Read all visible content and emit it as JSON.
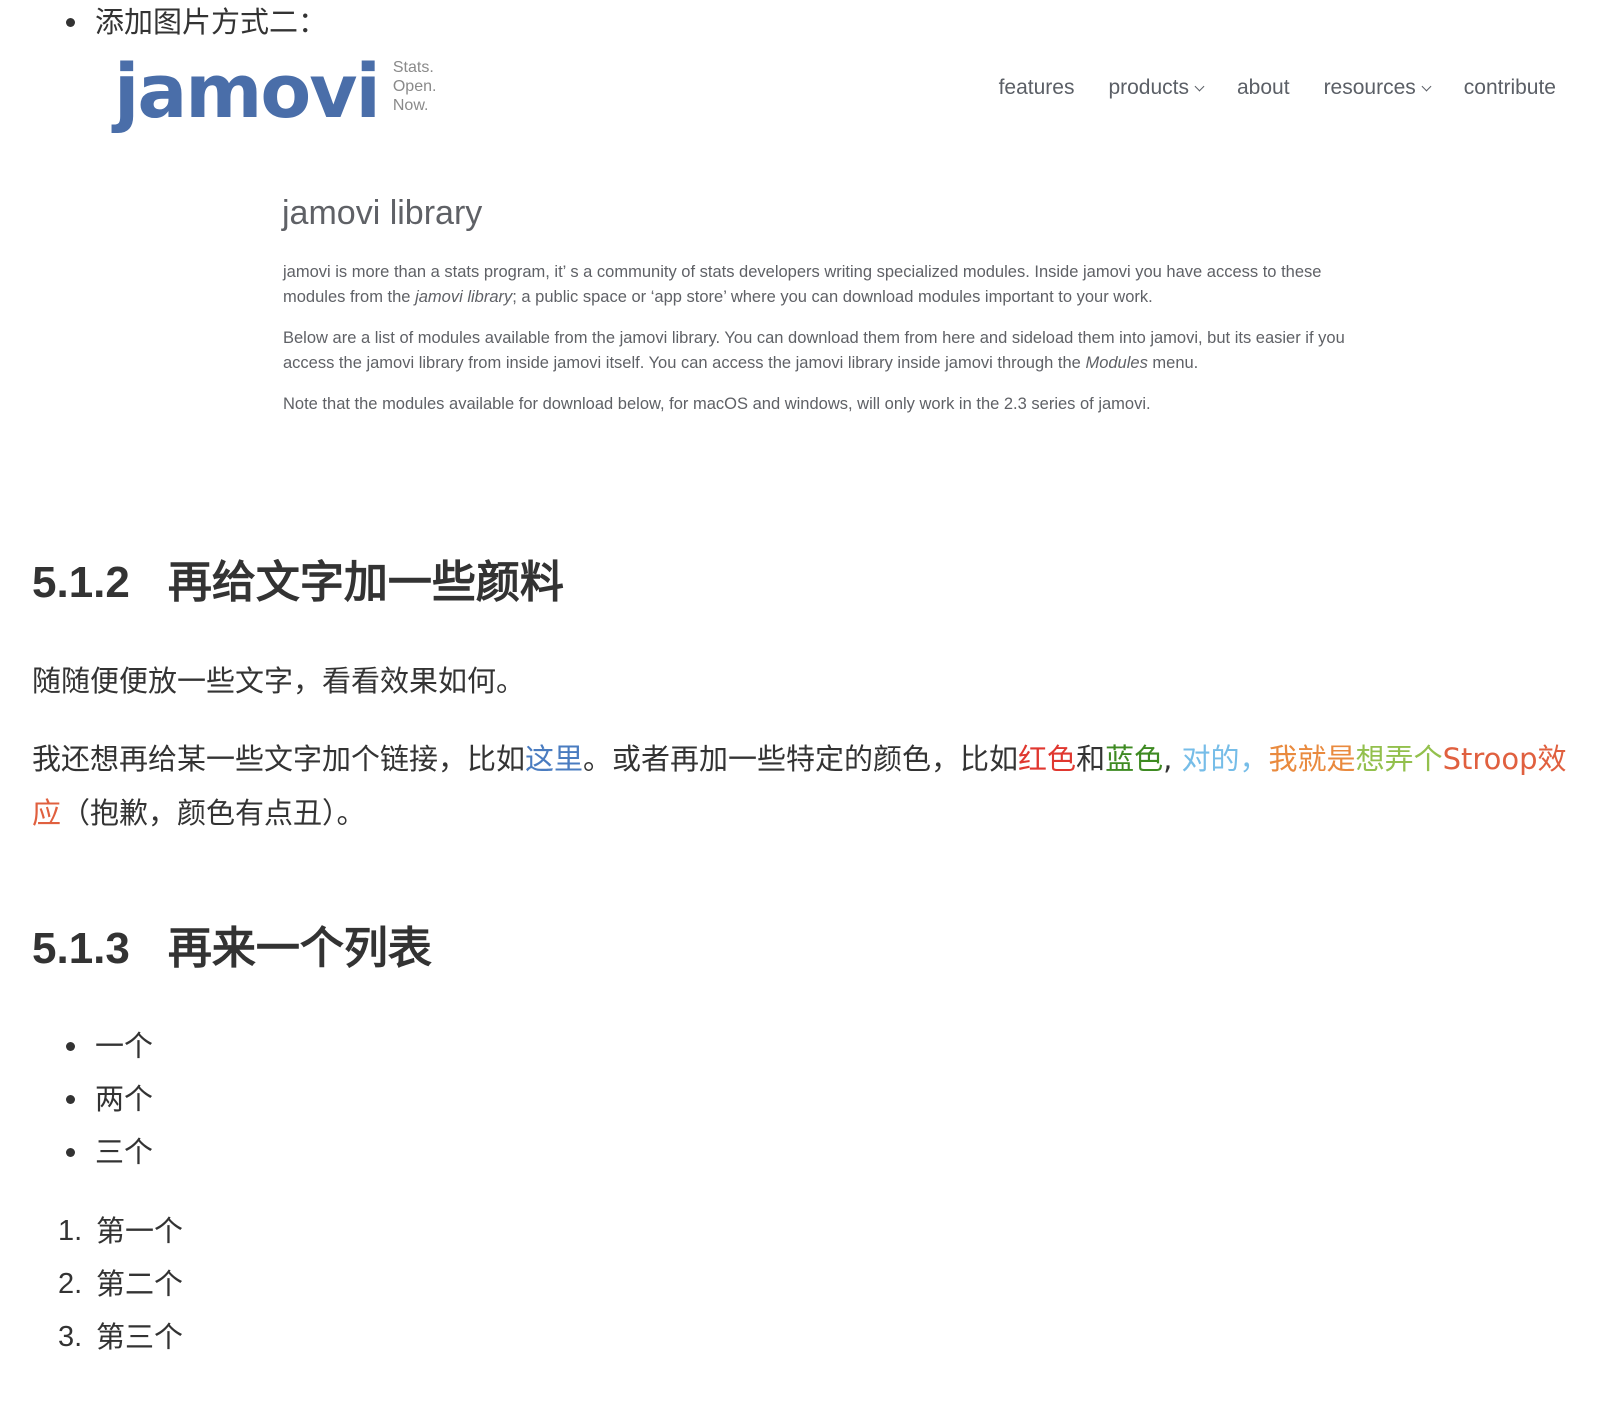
{
  "top_bullet": {
    "text": "添加图片方式二："
  },
  "embedded_image": {
    "logo": {
      "word": "jamovi",
      "tagline": [
        "Stats.",
        "Open.",
        "Now."
      ],
      "color": "#4a6ea9"
    },
    "nav": [
      {
        "label": "features",
        "dropdown": false
      },
      {
        "label": "products",
        "dropdown": true
      },
      {
        "label": "about",
        "dropdown": false
      },
      {
        "label": "resources",
        "dropdown": true
      },
      {
        "label": "contribute",
        "dropdown": false
      }
    ],
    "title": "jamovi library",
    "paragraphs": {
      "p1_a": "jamovi is more than a stats program, it’ s a community of stats developers writing specialized modules. Inside jamovi you have access to these modules from the ",
      "p1_em": "jamovi library",
      "p1_b": "; a public space or  ‘app store’  where you can download modules important to your work.",
      "p2_a": "Below are a list of modules available from the jamovi library. You can download them from here and sideload them into jamovi, but its easier if you access the jamovi library from inside jamovi itself. You can access the jamovi library inside jamovi through the ",
      "p2_em": "Modules",
      "p2_b": " menu.",
      "p3": "Note that the modules available for download below, for macOS and windows, will only work in the 2.3 series of jamovi."
    }
  },
  "section_512": {
    "number": "5.1.2",
    "title": "再给文字加一些颜料",
    "para1": "随随便便放一些文字，看看效果如何。",
    "para2": {
      "s1": "我还想再给某一些文字加个链接，比如",
      "link": "这里",
      "s2": "。或者再加一些特定的颜色，比如",
      "red": "红色",
      "s3": "和",
      "green": "蓝色",
      "s4": ",",
      "sky": "对的，",
      "orange": "我就是",
      "lime": "想弄个",
      "tomato": "Stroop效应",
      "s5": "（抱歉，颜色有点丑）。"
    },
    "colors": {
      "link": "#4a7cc0",
      "red": "#e0372f",
      "green": "#3e8a22",
      "sky": "#76bde8",
      "orange": "#e98a3e",
      "lime": "#93c04d",
      "tomato": "#e0603f"
    }
  },
  "section_513": {
    "number": "5.1.3",
    "title": "再来一个列表",
    "bullets": [
      "一个",
      "两个",
      "三个"
    ],
    "ordered": [
      {
        "num": "1.",
        "text": "第一个"
      },
      {
        "num": "2.",
        "text": "第二个"
      },
      {
        "num": "3.",
        "text": "第三个"
      }
    ]
  }
}
